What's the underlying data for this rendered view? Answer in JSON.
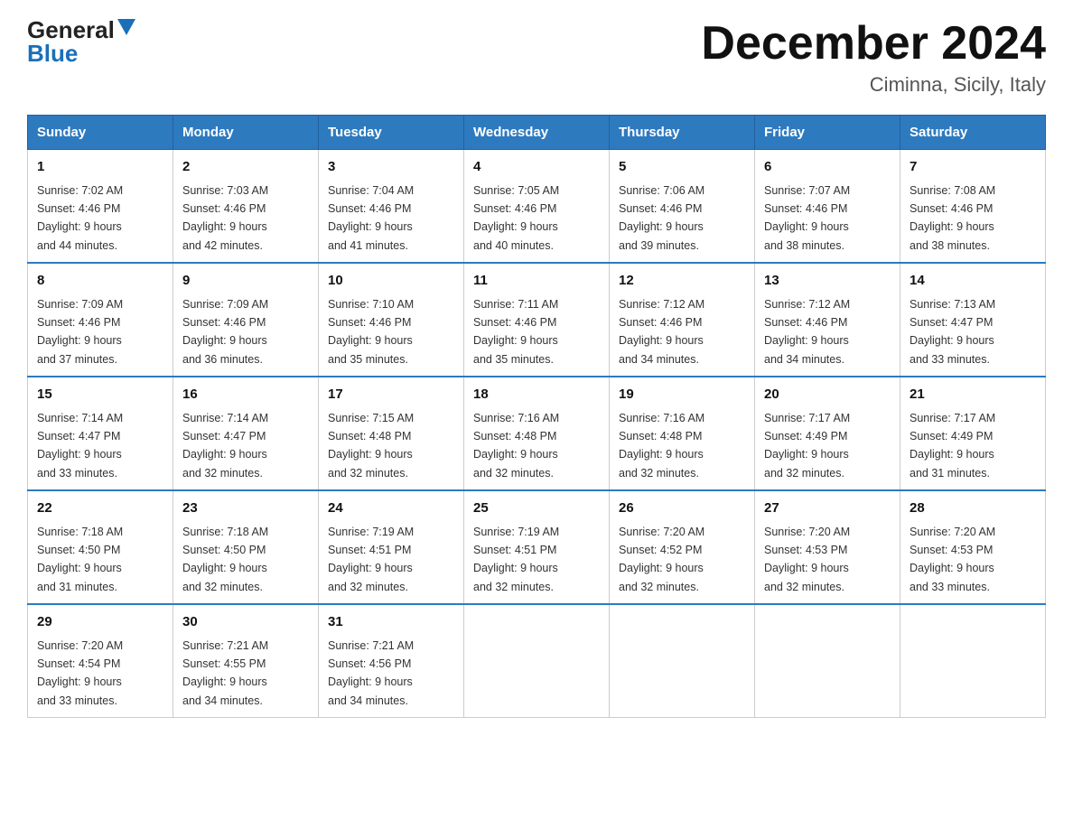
{
  "header": {
    "logo_general": "General",
    "logo_blue": "Blue",
    "month_year": "December 2024",
    "location": "Ciminna, Sicily, Italy"
  },
  "days_of_week": [
    "Sunday",
    "Monday",
    "Tuesday",
    "Wednesday",
    "Thursday",
    "Friday",
    "Saturday"
  ],
  "weeks": [
    [
      {
        "day": "1",
        "sunrise": "7:02 AM",
        "sunset": "4:46 PM",
        "daylight": "9 hours and 44 minutes."
      },
      {
        "day": "2",
        "sunrise": "7:03 AM",
        "sunset": "4:46 PM",
        "daylight": "9 hours and 42 minutes."
      },
      {
        "day": "3",
        "sunrise": "7:04 AM",
        "sunset": "4:46 PM",
        "daylight": "9 hours and 41 minutes."
      },
      {
        "day": "4",
        "sunrise": "7:05 AM",
        "sunset": "4:46 PM",
        "daylight": "9 hours and 40 minutes."
      },
      {
        "day": "5",
        "sunrise": "7:06 AM",
        "sunset": "4:46 PM",
        "daylight": "9 hours and 39 minutes."
      },
      {
        "day": "6",
        "sunrise": "7:07 AM",
        "sunset": "4:46 PM",
        "daylight": "9 hours and 38 minutes."
      },
      {
        "day": "7",
        "sunrise": "7:08 AM",
        "sunset": "4:46 PM",
        "daylight": "9 hours and 38 minutes."
      }
    ],
    [
      {
        "day": "8",
        "sunrise": "7:09 AM",
        "sunset": "4:46 PM",
        "daylight": "9 hours and 37 minutes."
      },
      {
        "day": "9",
        "sunrise": "7:09 AM",
        "sunset": "4:46 PM",
        "daylight": "9 hours and 36 minutes."
      },
      {
        "day": "10",
        "sunrise": "7:10 AM",
        "sunset": "4:46 PM",
        "daylight": "9 hours and 35 minutes."
      },
      {
        "day": "11",
        "sunrise": "7:11 AM",
        "sunset": "4:46 PM",
        "daylight": "9 hours and 35 minutes."
      },
      {
        "day": "12",
        "sunrise": "7:12 AM",
        "sunset": "4:46 PM",
        "daylight": "9 hours and 34 minutes."
      },
      {
        "day": "13",
        "sunrise": "7:12 AM",
        "sunset": "4:46 PM",
        "daylight": "9 hours and 34 minutes."
      },
      {
        "day": "14",
        "sunrise": "7:13 AM",
        "sunset": "4:47 PM",
        "daylight": "9 hours and 33 minutes."
      }
    ],
    [
      {
        "day": "15",
        "sunrise": "7:14 AM",
        "sunset": "4:47 PM",
        "daylight": "9 hours and 33 minutes."
      },
      {
        "day": "16",
        "sunrise": "7:14 AM",
        "sunset": "4:47 PM",
        "daylight": "9 hours and 32 minutes."
      },
      {
        "day": "17",
        "sunrise": "7:15 AM",
        "sunset": "4:48 PM",
        "daylight": "9 hours and 32 minutes."
      },
      {
        "day": "18",
        "sunrise": "7:16 AM",
        "sunset": "4:48 PM",
        "daylight": "9 hours and 32 minutes."
      },
      {
        "day": "19",
        "sunrise": "7:16 AM",
        "sunset": "4:48 PM",
        "daylight": "9 hours and 32 minutes."
      },
      {
        "day": "20",
        "sunrise": "7:17 AM",
        "sunset": "4:49 PM",
        "daylight": "9 hours and 32 minutes."
      },
      {
        "day": "21",
        "sunrise": "7:17 AM",
        "sunset": "4:49 PM",
        "daylight": "9 hours and 31 minutes."
      }
    ],
    [
      {
        "day": "22",
        "sunrise": "7:18 AM",
        "sunset": "4:50 PM",
        "daylight": "9 hours and 31 minutes."
      },
      {
        "day": "23",
        "sunrise": "7:18 AM",
        "sunset": "4:50 PM",
        "daylight": "9 hours and 32 minutes."
      },
      {
        "day": "24",
        "sunrise": "7:19 AM",
        "sunset": "4:51 PM",
        "daylight": "9 hours and 32 minutes."
      },
      {
        "day": "25",
        "sunrise": "7:19 AM",
        "sunset": "4:51 PM",
        "daylight": "9 hours and 32 minutes."
      },
      {
        "day": "26",
        "sunrise": "7:20 AM",
        "sunset": "4:52 PM",
        "daylight": "9 hours and 32 minutes."
      },
      {
        "day": "27",
        "sunrise": "7:20 AM",
        "sunset": "4:53 PM",
        "daylight": "9 hours and 32 minutes."
      },
      {
        "day": "28",
        "sunrise": "7:20 AM",
        "sunset": "4:53 PM",
        "daylight": "9 hours and 33 minutes."
      }
    ],
    [
      {
        "day": "29",
        "sunrise": "7:20 AM",
        "sunset": "4:54 PM",
        "daylight": "9 hours and 33 minutes."
      },
      {
        "day": "30",
        "sunrise": "7:21 AM",
        "sunset": "4:55 PM",
        "daylight": "9 hours and 34 minutes."
      },
      {
        "day": "31",
        "sunrise": "7:21 AM",
        "sunset": "4:56 PM",
        "daylight": "9 hours and 34 minutes."
      },
      null,
      null,
      null,
      null
    ]
  ]
}
